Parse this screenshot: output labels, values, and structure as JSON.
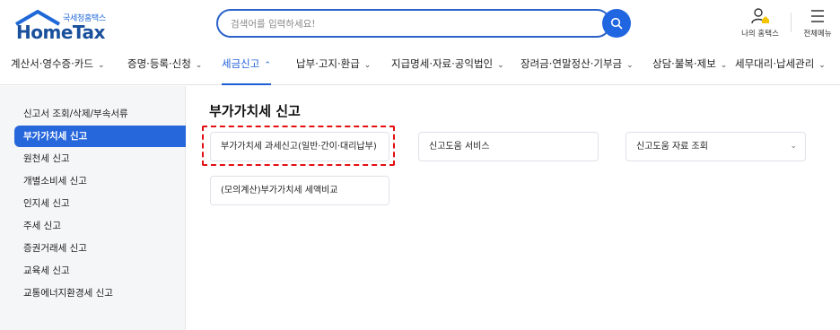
{
  "header": {
    "logo_small": "국세청홈택스",
    "logo_big": "HomeTax",
    "search_placeholder": "검색어를 입력하세요!",
    "my_hometax": "나의 홈택스",
    "all_menu": "전체메뉴"
  },
  "gnb": [
    {
      "label": "계산서·영수증·카드",
      "chevron": "⌄"
    },
    {
      "label": "증명·등록·신청",
      "chevron": "⌄"
    },
    {
      "label": "세금신고",
      "chevron": "⌃"
    },
    {
      "label": "납부·고지·환급",
      "chevron": "⌄"
    },
    {
      "label": "지급명세·자료·공익법인",
      "chevron": "⌄"
    },
    {
      "label": "장려금·연말정산·기부금",
      "chevron": "⌄"
    },
    {
      "label": "상담·불복·제보",
      "chevron": "⌄"
    },
    {
      "label": "세무대리·납세관리",
      "chevron": "⌄"
    }
  ],
  "sidebar": [
    {
      "label": "신고서 조회/삭제/부속서류"
    },
    {
      "label": "부가가치세 신고"
    },
    {
      "label": "원천세 신고"
    },
    {
      "label": "개별소비세 신고"
    },
    {
      "label": "인지세 신고"
    },
    {
      "label": "주세 신고"
    },
    {
      "label": "증권거래세 신고"
    },
    {
      "label": "교육세 신고"
    },
    {
      "label": "교통에너지환경세 신고"
    }
  ],
  "main": {
    "title": "부가가치세 신고",
    "cards": [
      {
        "label": "부가가치세 과세신고(일반·간이·대리납부)"
      },
      {
        "label": "신고도움 서비스"
      },
      {
        "label": "신고도움 자료 조회",
        "chevron": "⌄"
      },
      {
        "label": "(모의계산)부가가치세 세액비교"
      }
    ]
  },
  "colors": {
    "brand": "#1a4f9c",
    "accent": "#2767dc",
    "highlight": "#e30f12"
  },
  "icons": [
    "house-roof-logo",
    "search-icon",
    "my-hometax-icon",
    "hamburger-menu-icon",
    "chevron-down-icon",
    "chevron-up-icon"
  ]
}
